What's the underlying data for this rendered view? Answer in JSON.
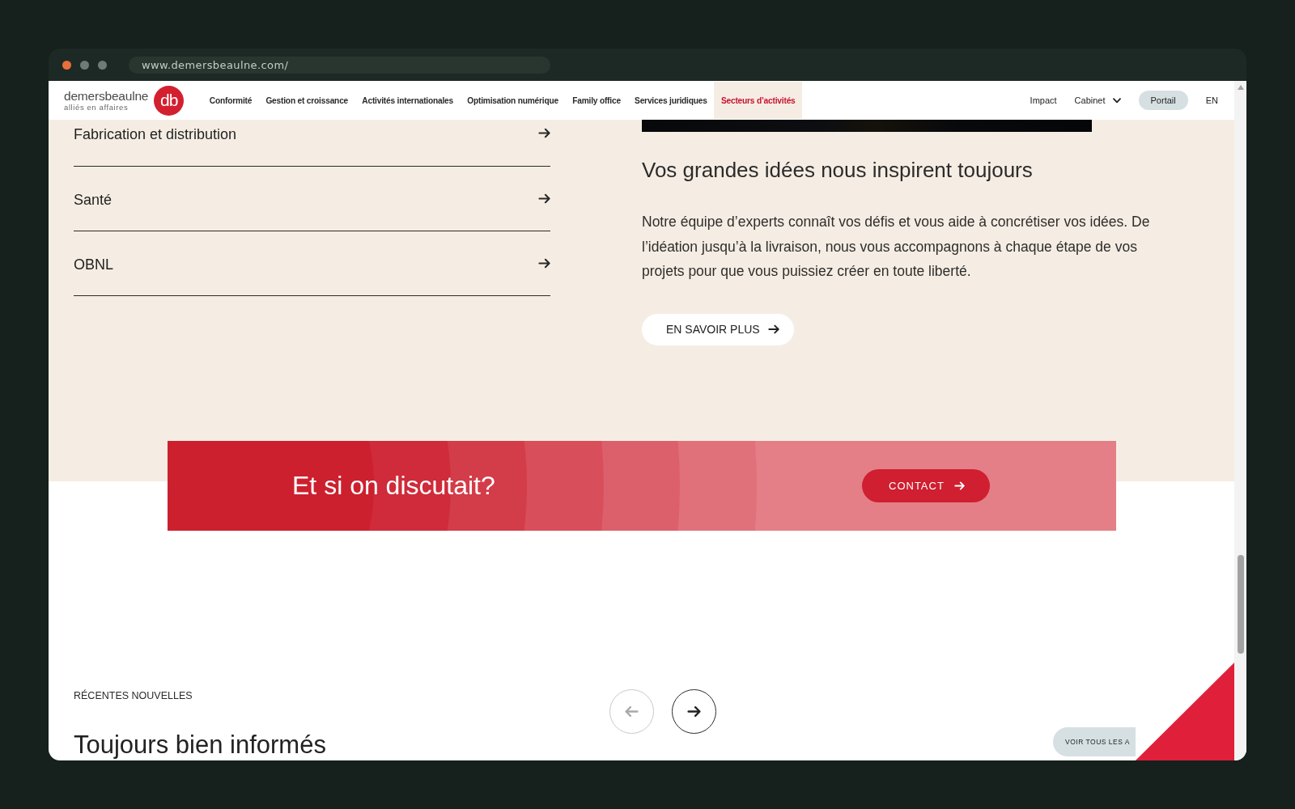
{
  "browser": {
    "url": "www.demersbeaulne.com/"
  },
  "header": {
    "logo": {
      "wordmark": "demersbeaulne",
      "tagline": "alliés en affaires",
      "mark": "db"
    },
    "nav": [
      {
        "label": "Conformité",
        "selected": false
      },
      {
        "label": "Gestion et croissance",
        "selected": false
      },
      {
        "label": "Activités internationales",
        "selected": false
      },
      {
        "label": "Optimisation numérique",
        "selected": false
      },
      {
        "label": "Family office",
        "selected": false
      },
      {
        "label": "Services juridiques",
        "selected": false
      },
      {
        "label": "Secteurs d’activités",
        "selected": true
      }
    ],
    "utility": [
      {
        "kind": "link",
        "label": "Impact"
      },
      {
        "kind": "dropdown",
        "label": "Cabinet"
      },
      {
        "kind": "pill",
        "label": "Portail"
      },
      {
        "kind": "link",
        "label": "EN"
      }
    ]
  },
  "sectors": [
    {
      "label": "Fabrication et distribution"
    },
    {
      "label": "Santé"
    },
    {
      "label": "OBNL"
    }
  ],
  "feature": {
    "title": "Vos grandes idées nous inspirent toujours",
    "body": "Notre équipe d’experts connaît vos défis et vous aide à concrétiser vos idées. De l’idéation jusqu’à la livraison, nous vous accompagnons à chaque étape de vos projets pour que vous puissiez créer en toute liberté.",
    "button": "EN SAVOIR PLUS"
  },
  "cta": {
    "title": "Et si on discutait?",
    "button": "CONTACT"
  },
  "news": {
    "eyebrow": "RÉCENTES NOUVELLES",
    "title": "Toujours bien informés",
    "carousel": [
      {
        "kind": "previous",
        "disabled": true
      },
      {
        "kind": "next",
        "disabled": false
      }
    ],
    "all_button": "VOIR TOUS LES A"
  }
}
